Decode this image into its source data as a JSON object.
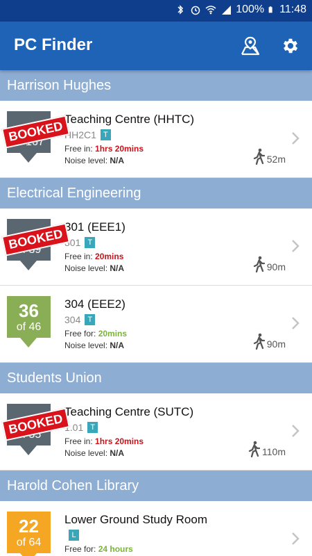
{
  "status": {
    "battery": "100%",
    "time": "11:48"
  },
  "app": {
    "title": "PC Finder"
  },
  "sections": [
    {
      "title": "Harrison Hughes",
      "items": [
        {
          "badge_num": "",
          "badge_of": "of 167",
          "booked": true,
          "booked_label": "BOOKED",
          "badge_color": "#5b6770",
          "name": "Teaching Centre (HHTC)",
          "code": "HH2C1",
          "tag": "T",
          "free_label": "Free in: ",
          "free_value": "1hrs 20mins",
          "free_color": "red",
          "noise_label": "Noise level: ",
          "noise_value": "N/A",
          "distance": "52m"
        }
      ]
    },
    {
      "title": "Electrical Engineering",
      "items": [
        {
          "badge_num": "",
          "badge_of": "of 39",
          "booked": true,
          "booked_label": "BOOKED",
          "badge_color": "#5b6770",
          "name": "301 (EEE1)",
          "code": "301",
          "tag": "T",
          "free_label": "Free in: ",
          "free_value": "20mins",
          "free_color": "red",
          "noise_label": "Noise level: ",
          "noise_value": "N/A",
          "distance": "90m"
        },
        {
          "badge_num": "36",
          "badge_of": "of 46",
          "booked": false,
          "booked_label": "",
          "badge_color": "#8aae55",
          "name": "304 (EEE2)",
          "code": "304",
          "tag": "T",
          "free_label": "Free for: ",
          "free_value": "20mins",
          "free_color": "green",
          "noise_label": "Noise level: ",
          "noise_value": "N/A",
          "distance": "90m"
        }
      ]
    },
    {
      "title": "Students Union",
      "items": [
        {
          "badge_num": "",
          "badge_of": "of 55",
          "booked": true,
          "booked_label": "BOOKED",
          "badge_color": "#5b6770",
          "name": "Teaching Centre (SUTC)",
          "code": "1.01",
          "tag": "T",
          "free_label": "Free in: ",
          "free_value": "1hrs 20mins",
          "free_color": "red",
          "noise_label": "Noise level: ",
          "noise_value": "N/A",
          "distance": "110m"
        }
      ]
    },
    {
      "title": "Harold Cohen Library",
      "items": [
        {
          "badge_num": "22",
          "badge_of": "of 64",
          "booked": false,
          "booked_label": "",
          "badge_color": "#f5a623",
          "name": "Lower Ground Study Room",
          "code": "",
          "tag": "L",
          "free_label": "Free for: ",
          "free_value": "24 hours",
          "free_color": "green",
          "noise_label": "",
          "noise_value": "",
          "distance": ""
        }
      ]
    }
  ]
}
